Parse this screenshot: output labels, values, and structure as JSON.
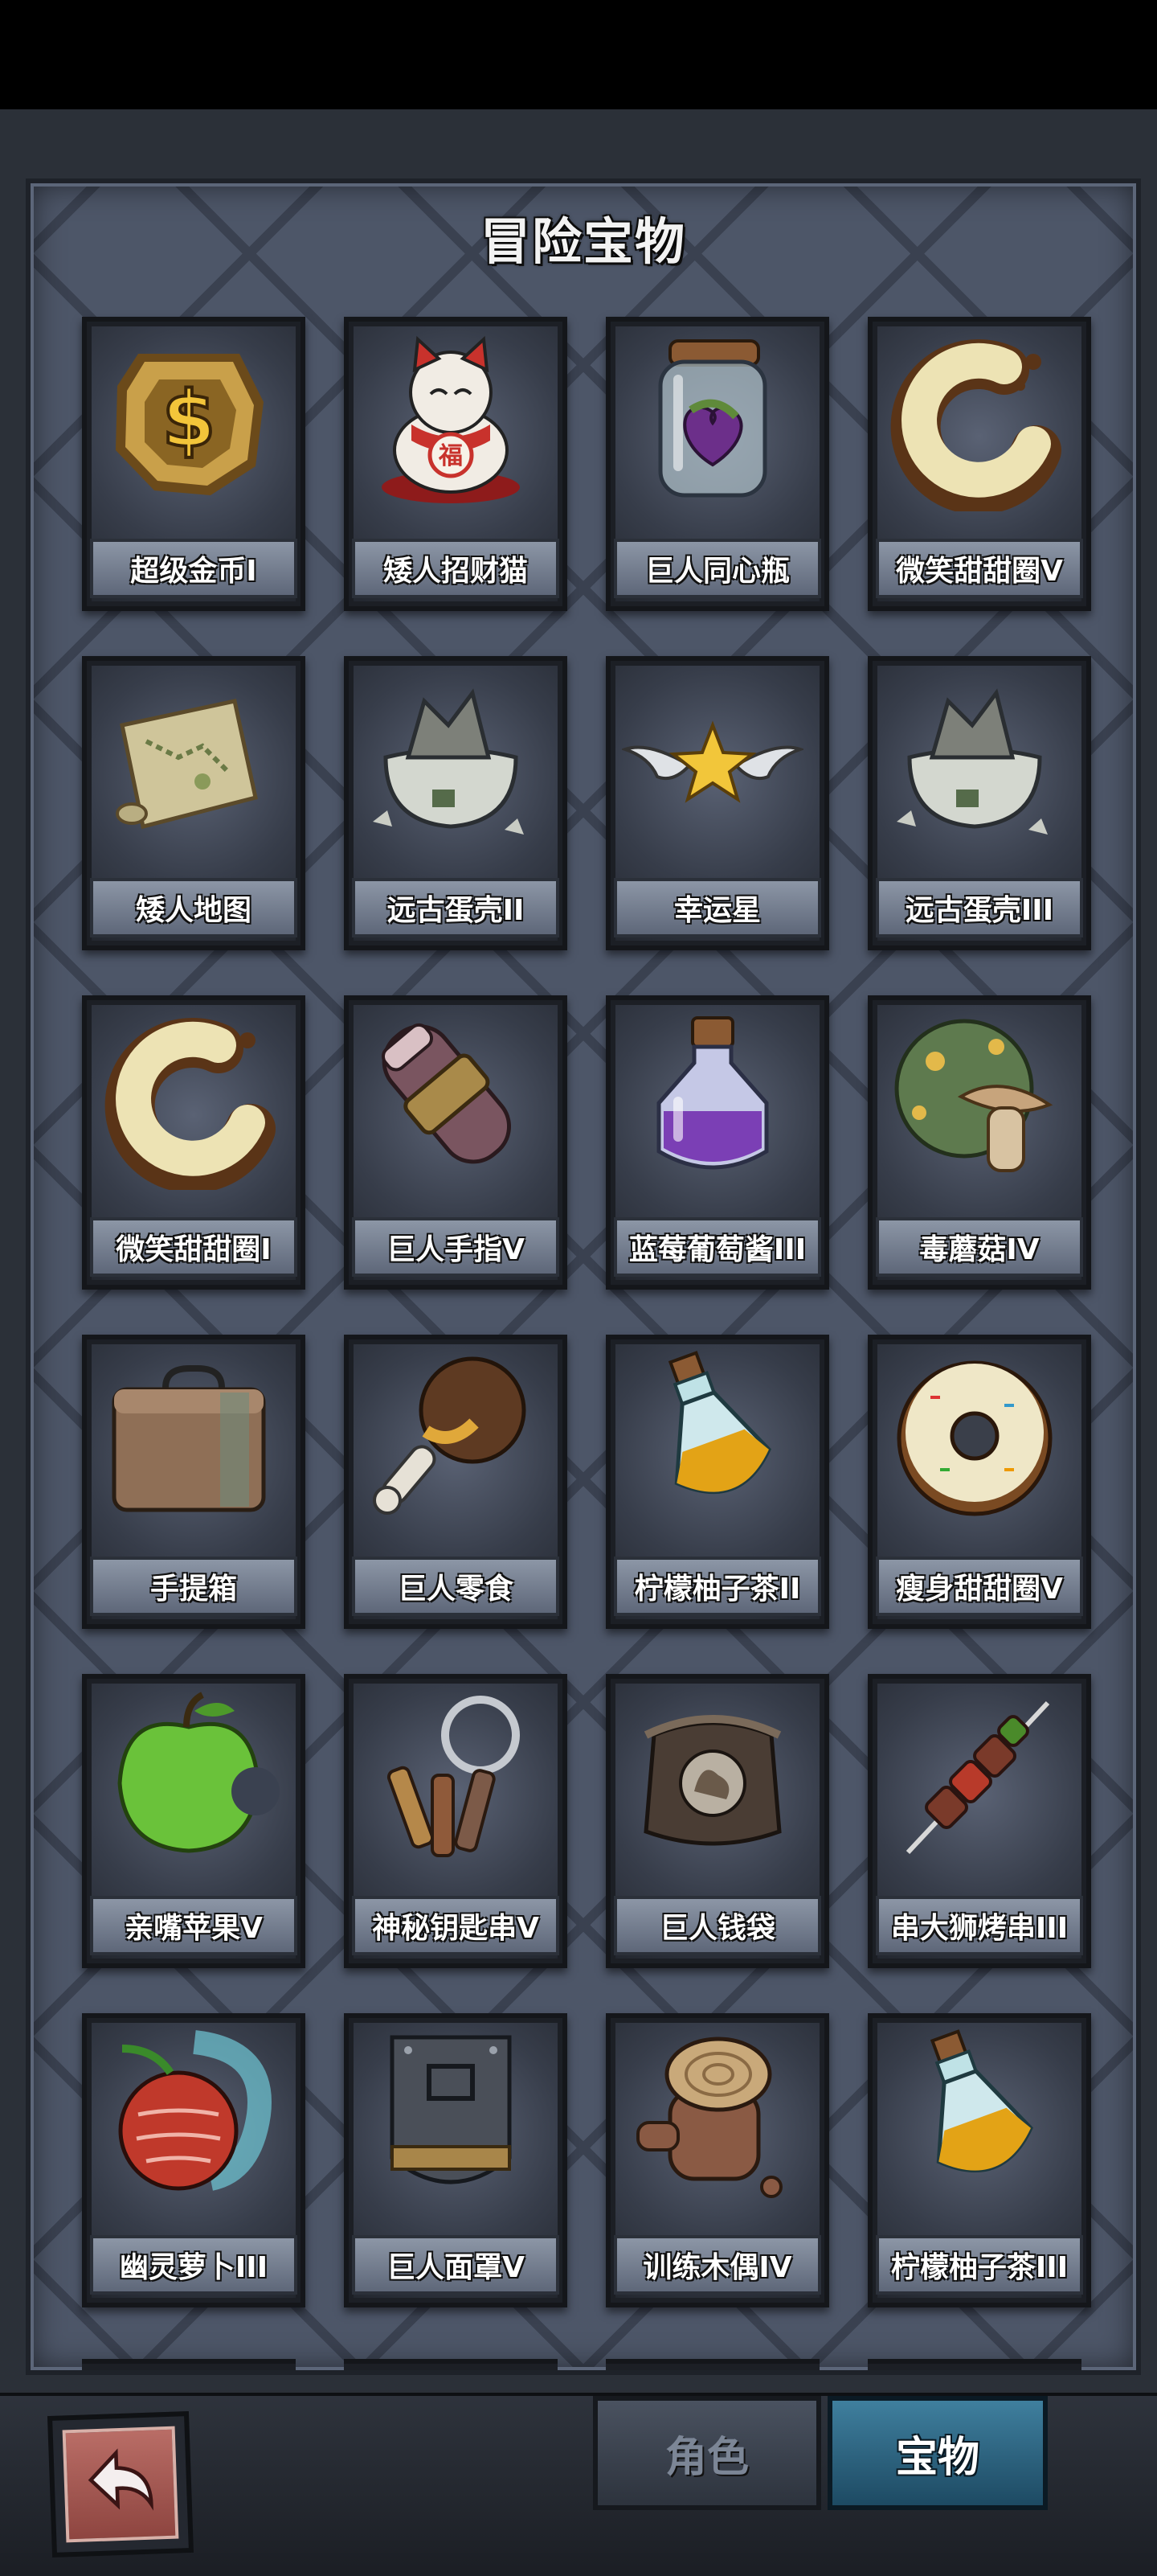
{
  "title": "冒险宝物",
  "items": [
    {
      "label": "超级金币I",
      "icon": "gold-coin-icon"
    },
    {
      "label": "矮人招财猫",
      "icon": "lucky-cat-icon"
    },
    {
      "label": "巨人同心瓶",
      "icon": "heart-jar-icon"
    },
    {
      "label": "微笑甜甜圈V",
      "icon": "smile-donut-icon"
    },
    {
      "label": "矮人地图",
      "icon": "map-scroll-icon"
    },
    {
      "label": "远古蛋壳II",
      "icon": "eggshell-icon"
    },
    {
      "label": "幸运星",
      "icon": "winged-star-icon"
    },
    {
      "label": "远古蛋壳III",
      "icon": "eggshell-icon"
    },
    {
      "label": "微笑甜甜圈I",
      "icon": "smile-donut-icon"
    },
    {
      "label": "巨人手指V",
      "icon": "giant-finger-icon"
    },
    {
      "label": "蓝莓葡萄酱III",
      "icon": "jam-bottle-icon"
    },
    {
      "label": "毒蘑菇IV",
      "icon": "poison-mushroom-icon"
    },
    {
      "label": "手提箱",
      "icon": "suitcase-icon"
    },
    {
      "label": "巨人零食",
      "icon": "meat-bone-icon"
    },
    {
      "label": "柠檬柚子茶II",
      "icon": "tea-bottle-icon"
    },
    {
      "label": "瘦身甜甜圈V",
      "icon": "sprinkle-donut-icon"
    },
    {
      "label": "亲嘴苹果V",
      "icon": "bitten-apple-icon"
    },
    {
      "label": "神秘钥匙串V",
      "icon": "key-ring-icon"
    },
    {
      "label": "巨人钱袋",
      "icon": "money-bag-icon"
    },
    {
      "label": "串大狮烤串III",
      "icon": "skewer-icon"
    },
    {
      "label": "幽灵萝卜III",
      "icon": "ghost-radish-icon"
    },
    {
      "label": "巨人面罩V",
      "icon": "giant-mask-icon"
    },
    {
      "label": "训练木偶IV",
      "icon": "training-dummy-icon"
    },
    {
      "label": "柠檬柚子茶III",
      "icon": "tea-bottle-icon"
    }
  ],
  "tabs": {
    "role": "角色",
    "treasure": "宝物",
    "active": "treasure"
  },
  "back_icon": "back-arrow-icon",
  "colors": {
    "panel": "#4d5668",
    "active_tab": "#2e6a89",
    "back_button": "#a65a54"
  }
}
